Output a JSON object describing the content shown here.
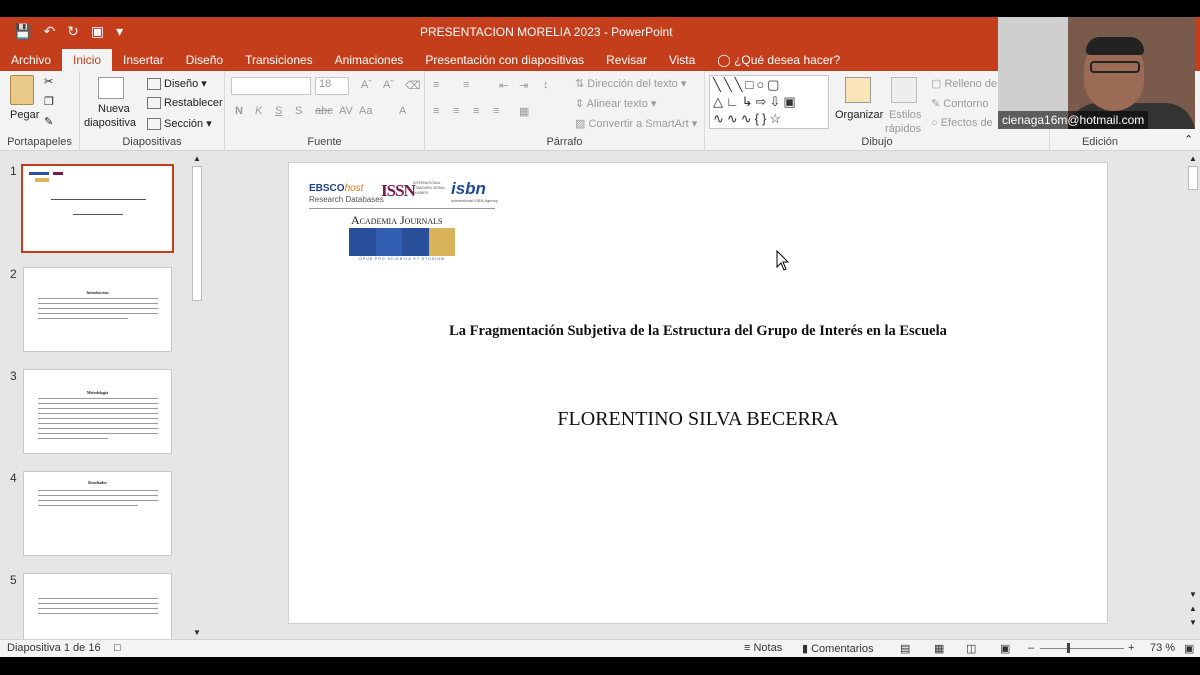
{
  "window": {
    "title": "PRESENTACION MORELIA 2023 - PowerPoint"
  },
  "tabs": [
    "Archivo",
    "Inicio",
    "Insertar",
    "Diseño",
    "Transiciones",
    "Animaciones",
    "Presentación con diapositivas",
    "Revisar",
    "Vista",
    "¿Qué desea hacer?"
  ],
  "ribbon": {
    "clipboard": {
      "paste": "Pegar",
      "group": "Portapapeles"
    },
    "slides": {
      "new_line1": "Nueva",
      "new_line2": "diapositiva",
      "layout": "Diseño",
      "reset": "Restablecer",
      "section": "Sección",
      "group": "Diapositivas"
    },
    "font": {
      "name_value": "",
      "size_value": "18",
      "group": "Fuente"
    },
    "paragraph": {
      "text_direction": "Dirección del texto",
      "align_text": "Alinear texto",
      "smartart": "Convertir a SmartArt",
      "group": "Párrafo"
    },
    "drawing": {
      "arrange": "Organizar",
      "quick_styles_1": "Estilos",
      "quick_styles_2": "rápidos",
      "fill": "Relleno de",
      "outline": "Contorno",
      "effects": "Efectos de",
      "group": "Dibujo"
    },
    "editing": {
      "group": "Edición"
    }
  },
  "webcam": {
    "email": "cienaga16m@hotmail.com"
  },
  "thumbnails": [
    {
      "num": "1"
    },
    {
      "num": "2",
      "heading": "Introducción"
    },
    {
      "num": "3",
      "heading": "Metodología"
    },
    {
      "num": "4",
      "heading": "Resultados"
    },
    {
      "num": "5"
    }
  ],
  "slide": {
    "logos": {
      "ebsco_1": "EBSCO",
      "ebsco_2": "host",
      "ebsco_sub": "Research Databases",
      "issn": "ISSN",
      "issn_sub": "INTERNATIONAL STANDARD SERIAL NUMBER",
      "isbn": "isbn",
      "isbn_sub": "International ISBN Agency",
      "academia": "Academia Journals",
      "academia_motto": "OPUS PRO SCIENTIA ET STUDIUM"
    },
    "title": "La Fragmentación Subjetiva de la Estructura del Grupo de Interés en la Escuela",
    "author": "FLORENTINO SILVA BECERRA"
  },
  "status": {
    "slide_counter": "Diapositiva 1 de 16",
    "notes": "Notas",
    "comments": "Comentarios",
    "zoom": "73 %"
  },
  "colors": {
    "accent": "#c43e1c",
    "academia_blue": "#2a4f9a",
    "academia_gold": "#d9b35a",
    "isbn_blue": "#1f4a9a",
    "issn_purple": "#7a1a4a"
  }
}
